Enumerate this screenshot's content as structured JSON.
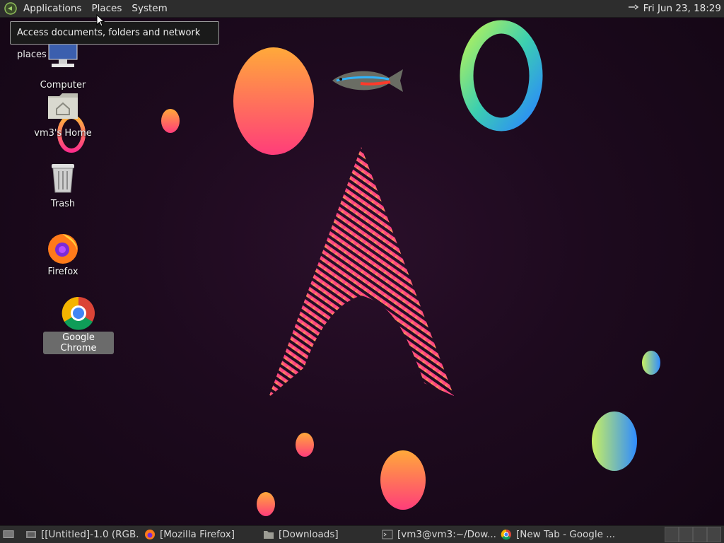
{
  "top_panel": {
    "menus": [
      "Applications",
      "Places",
      "System"
    ],
    "clock": "Fri Jun 23, 18:29"
  },
  "tooltip": {
    "text": "Access documents, folders and network places"
  },
  "desktop": {
    "icons": [
      {
        "label": "Computer",
        "icon": "computer-icon"
      },
      {
        "label": "vm3's Home",
        "icon": "home-folder-icon"
      },
      {
        "label": "Trash",
        "icon": "trash-icon"
      },
      {
        "label": "Firefox",
        "icon": "firefox-icon"
      },
      {
        "label": "Google Chrome",
        "icon": "chrome-icon",
        "selected": true
      }
    ]
  },
  "taskbar": {
    "items": [
      {
        "label": "[[Untitled]-1.0 (RGB...",
        "icon": "gimp-icon"
      },
      {
        "label": "[Mozilla Firefox]",
        "icon": "firefox-icon"
      },
      {
        "label": "[Downloads]",
        "icon": "folder-icon"
      },
      {
        "label": "[vm3@vm3:~/Dow...",
        "icon": "terminal-icon"
      },
      {
        "label": "[New Tab - Google ...",
        "icon": "chrome-icon"
      }
    ]
  },
  "colors": {
    "panel": "#2d2d2d",
    "desktop_bg": "#1d0a1e",
    "accent_pink": "#ff3d7f",
    "accent_orange": "#ffa23a"
  }
}
